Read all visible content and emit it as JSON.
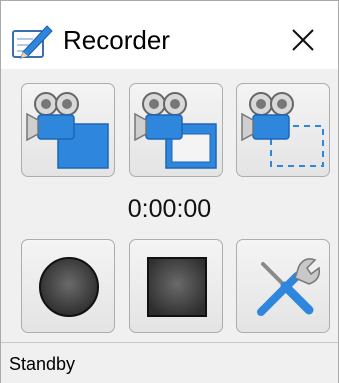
{
  "window": {
    "title": "Recorder",
    "app_icon": "pen-notepad-icon",
    "close_icon": "close-icon"
  },
  "toolbar_top": [
    {
      "name": "record-fullscreen-button",
      "icon": "camera-fullscreen-icon"
    },
    {
      "name": "record-window-button",
      "icon": "camera-window-icon"
    },
    {
      "name": "record-region-button",
      "icon": "camera-region-icon"
    }
  ],
  "timer": {
    "value": "0:00:00"
  },
  "toolbar_bottom": [
    {
      "name": "record-button",
      "icon": "record-circle-icon"
    },
    {
      "name": "stop-button",
      "icon": "stop-square-icon"
    },
    {
      "name": "settings-button",
      "icon": "tools-wrench-screwdriver-icon"
    }
  ],
  "status": {
    "text": "Standby"
  },
  "colors": {
    "accent_blue": "#2f86dd",
    "titlebar_bg": "#ffffff",
    "window_bg": "#f0f0f0"
  }
}
